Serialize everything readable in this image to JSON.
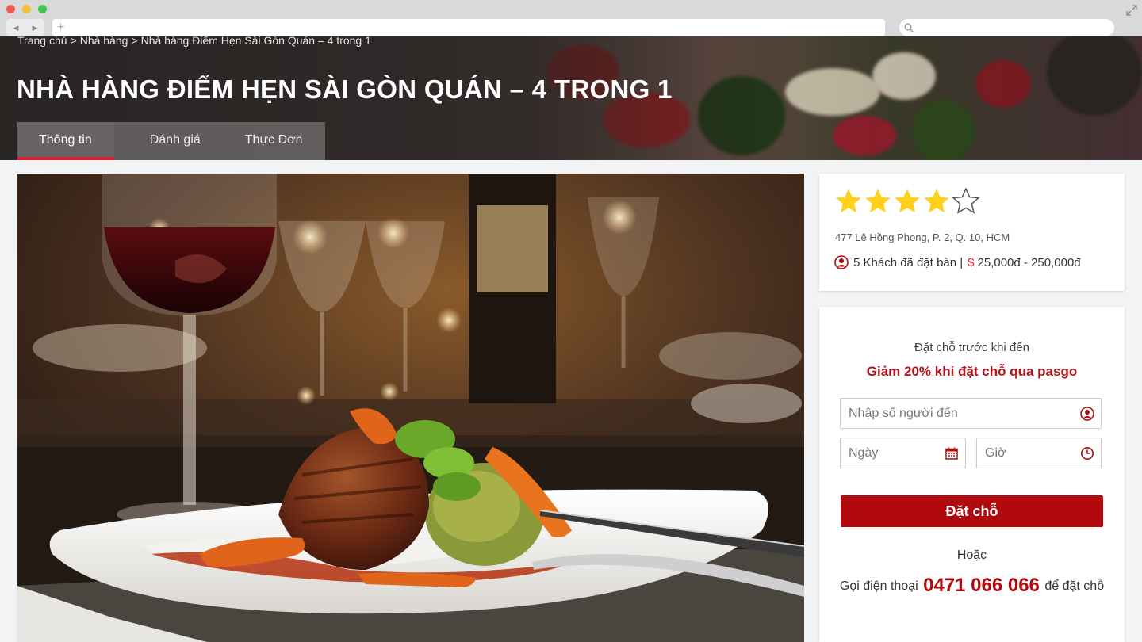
{
  "browser": {
    "back_icon": "back-arrow-icon",
    "forward_icon": "forward-arrow-icon",
    "new_tab_symbol": "+",
    "search_icon": "search-icon",
    "expand_icon": "expand-icon"
  },
  "breadcrumb": {
    "items": [
      "Trang chủ",
      "Nhà hàng",
      "Nhà hàng Điểm Hẹn Sài Gòn Quán – 4 trong 1"
    ],
    "separator": ">"
  },
  "page_title": "NHÀ HÀNG ĐIỂM HẸN SÀI GÒN QUÁN – 4 TRONG 1",
  "tabs": [
    {
      "label": "Thông tin",
      "active": true
    },
    {
      "label": "Đánh giá",
      "active": false
    },
    {
      "label": "Thực Đơn",
      "active": false
    }
  ],
  "photo": {
    "subject": "grilled steak with mashed potatoes, carrots, and red wine glass"
  },
  "info": {
    "rating": 4,
    "rating_max": 5,
    "address": "477 Lê Hồng Phong, P. 2, Q. 10, HCM",
    "guests_text": "5 Khách đã đặt bàn |",
    "price_symbol": "$",
    "price_range": "25,000đ - 250,000đ"
  },
  "booking": {
    "subtitle": "Đặt chỗ trước khi đến",
    "promo": "Giảm 20% khi đặt chỗ qua pasgo",
    "guests_placeholder": "Nhập số người đến",
    "date_placeholder": "Ngày",
    "time_placeholder": "Giờ",
    "submit_label": "Đặt chỗ",
    "or_label": "Hoặc",
    "call_prefix": "Gọi điện thoại",
    "phone": "0471 066 066",
    "call_suffix": "để đặt chỗ"
  },
  "colors": {
    "accent": "#b00a0f",
    "tab_underline": "#d8203b",
    "star": "#ffd11a"
  }
}
